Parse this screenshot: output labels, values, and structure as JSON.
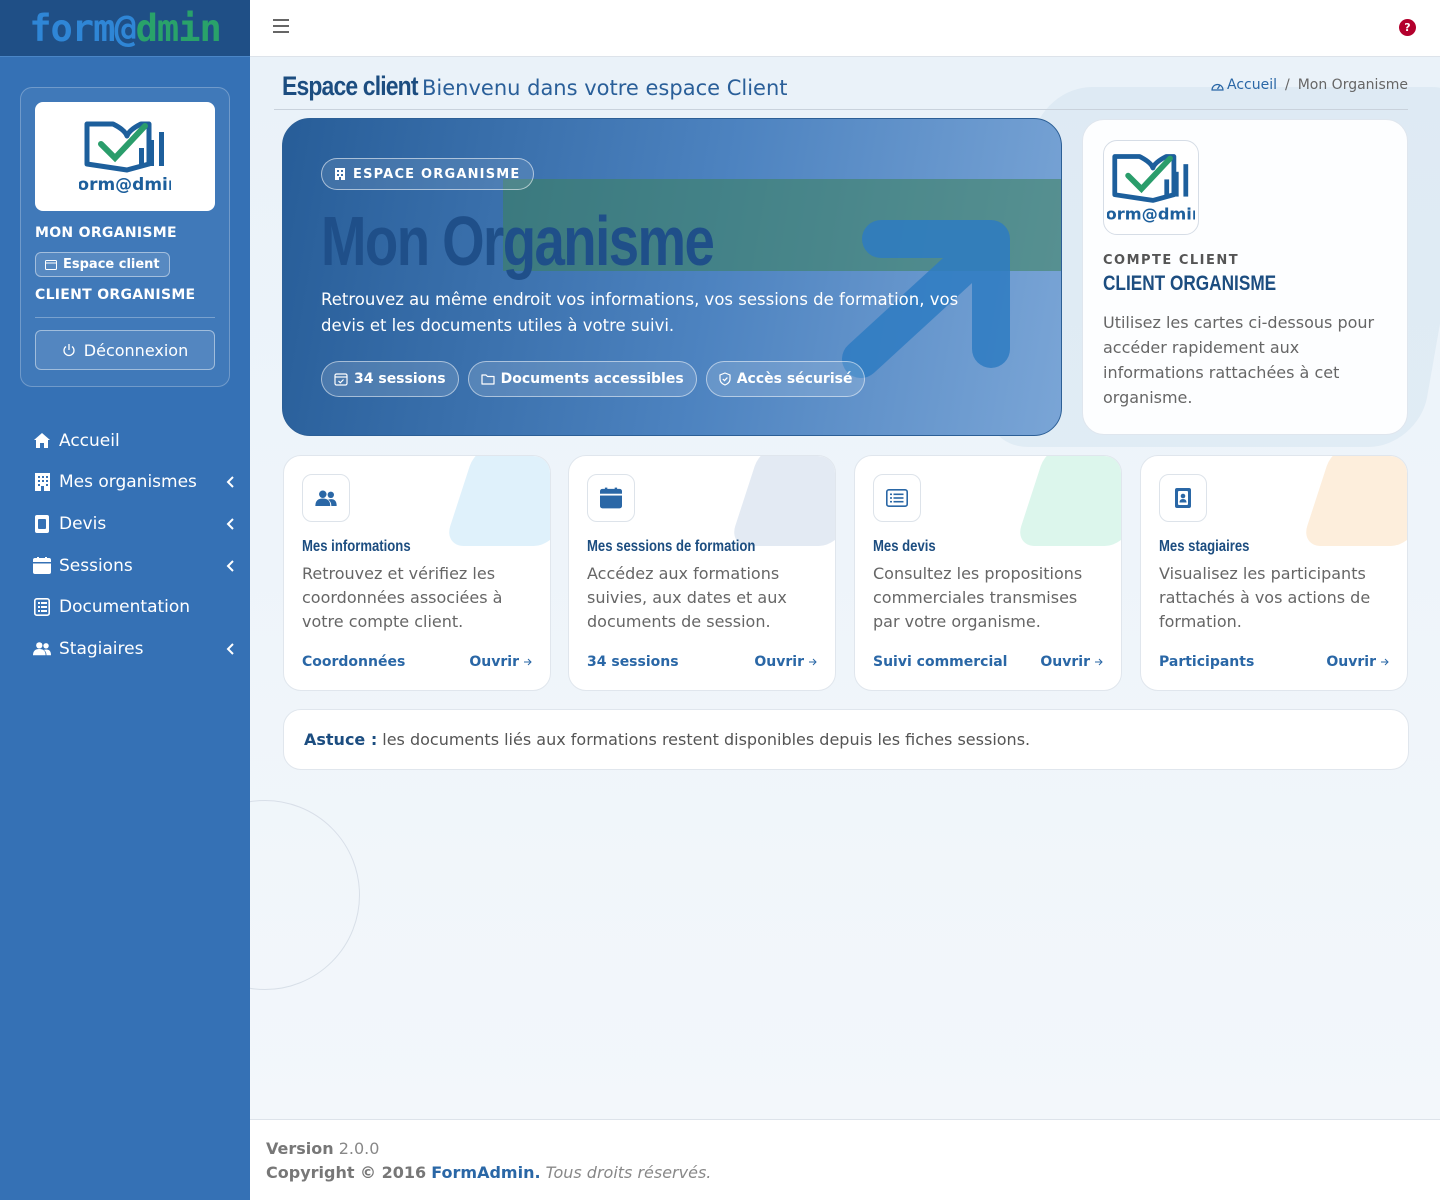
{
  "brand": {
    "part1": "form@",
    "part2": "dmin"
  },
  "sidebar": {
    "logo_text": "form@dmin",
    "org_name": "MON ORGANISME",
    "espace_label": "Espace client",
    "client_name": "CLIENT ORGANISME",
    "logout_label": "Déconnexion",
    "nav": [
      {
        "label": "Accueil",
        "icon": "home-icon",
        "has_children": false
      },
      {
        "label": "Mes organismes",
        "icon": "building-icon",
        "has_children": true
      },
      {
        "label": "Devis",
        "icon": "file-icon",
        "has_children": true
      },
      {
        "label": "Sessions",
        "icon": "calendar-icon",
        "has_children": true
      },
      {
        "label": "Documentation",
        "icon": "document-icon",
        "has_children": false
      },
      {
        "label": "Stagiaires",
        "icon": "users-icon",
        "has_children": true
      }
    ]
  },
  "topbar": {
    "help_label": "?"
  },
  "header": {
    "title": "Espace client",
    "subtitle": "Bienvenu dans votre espace Client",
    "breadcrumb_home": "Accueil",
    "breadcrumb_sep": "/",
    "breadcrumb_current": "Mon Organisme"
  },
  "hero": {
    "badge": "ESPACE ORGANISME",
    "title": "Mon Organisme",
    "text": "Retrouvez au même endroit vos informations, vos sessions de formation, vos devis et les documents utiles à votre suivi.",
    "pills": [
      "34 sessions",
      "Documents accessibles",
      "Accès sécurisé"
    ]
  },
  "account": {
    "logo_text": "form@dmin",
    "kicker": "COMPTE CLIENT",
    "title": "CLIENT ORGANISME",
    "text": "Utilisez les cartes ci-dessous pour accéder rapidement aux informations rattachées à cet organisme."
  },
  "cards": [
    {
      "title": "Mes informations",
      "text": "Retrouvez et vérifiez les coordonnées associées à votre compte client.",
      "meta": "Coordonnées",
      "link": "Ouvrir",
      "icon": "users-icon",
      "accent": "#dff1fb"
    },
    {
      "title": "Mes sessions de formation",
      "text": "Accédez aux formations suivies, aux dates et aux documents de session.",
      "meta": "34 sessions",
      "link": "Ouvrir",
      "icon": "calendar-icon",
      "accent": "#e3eaf3"
    },
    {
      "title": "Mes devis",
      "text": "Consultez les propositions commerciales transmises par votre organisme.",
      "meta": "Suivi commercial",
      "link": "Ouvrir",
      "icon": "list-icon",
      "accent": "#dcf6ec"
    },
    {
      "title": "Mes stagiaires",
      "text": "Visualisez les participants rattachés à vos actions de formation.",
      "meta": "Participants",
      "link": "Ouvrir",
      "icon": "id-badge-icon",
      "accent": "#fdeedc"
    }
  ],
  "tip": {
    "label": "Astuce :",
    "text": "les documents liés aux formations restent disponibles depuis les fiches sessions."
  },
  "footer": {
    "version_label": "Version",
    "version": "2.0.0",
    "copyright": "Copyright © 2016",
    "company": "FormAdmin.",
    "rights": "Tous droits réservés."
  },
  "colors": {
    "sidebar": "#3571b5",
    "brand_dark": "#1f4f86",
    "accent": "#2a67a6",
    "help": "#b3002d"
  }
}
